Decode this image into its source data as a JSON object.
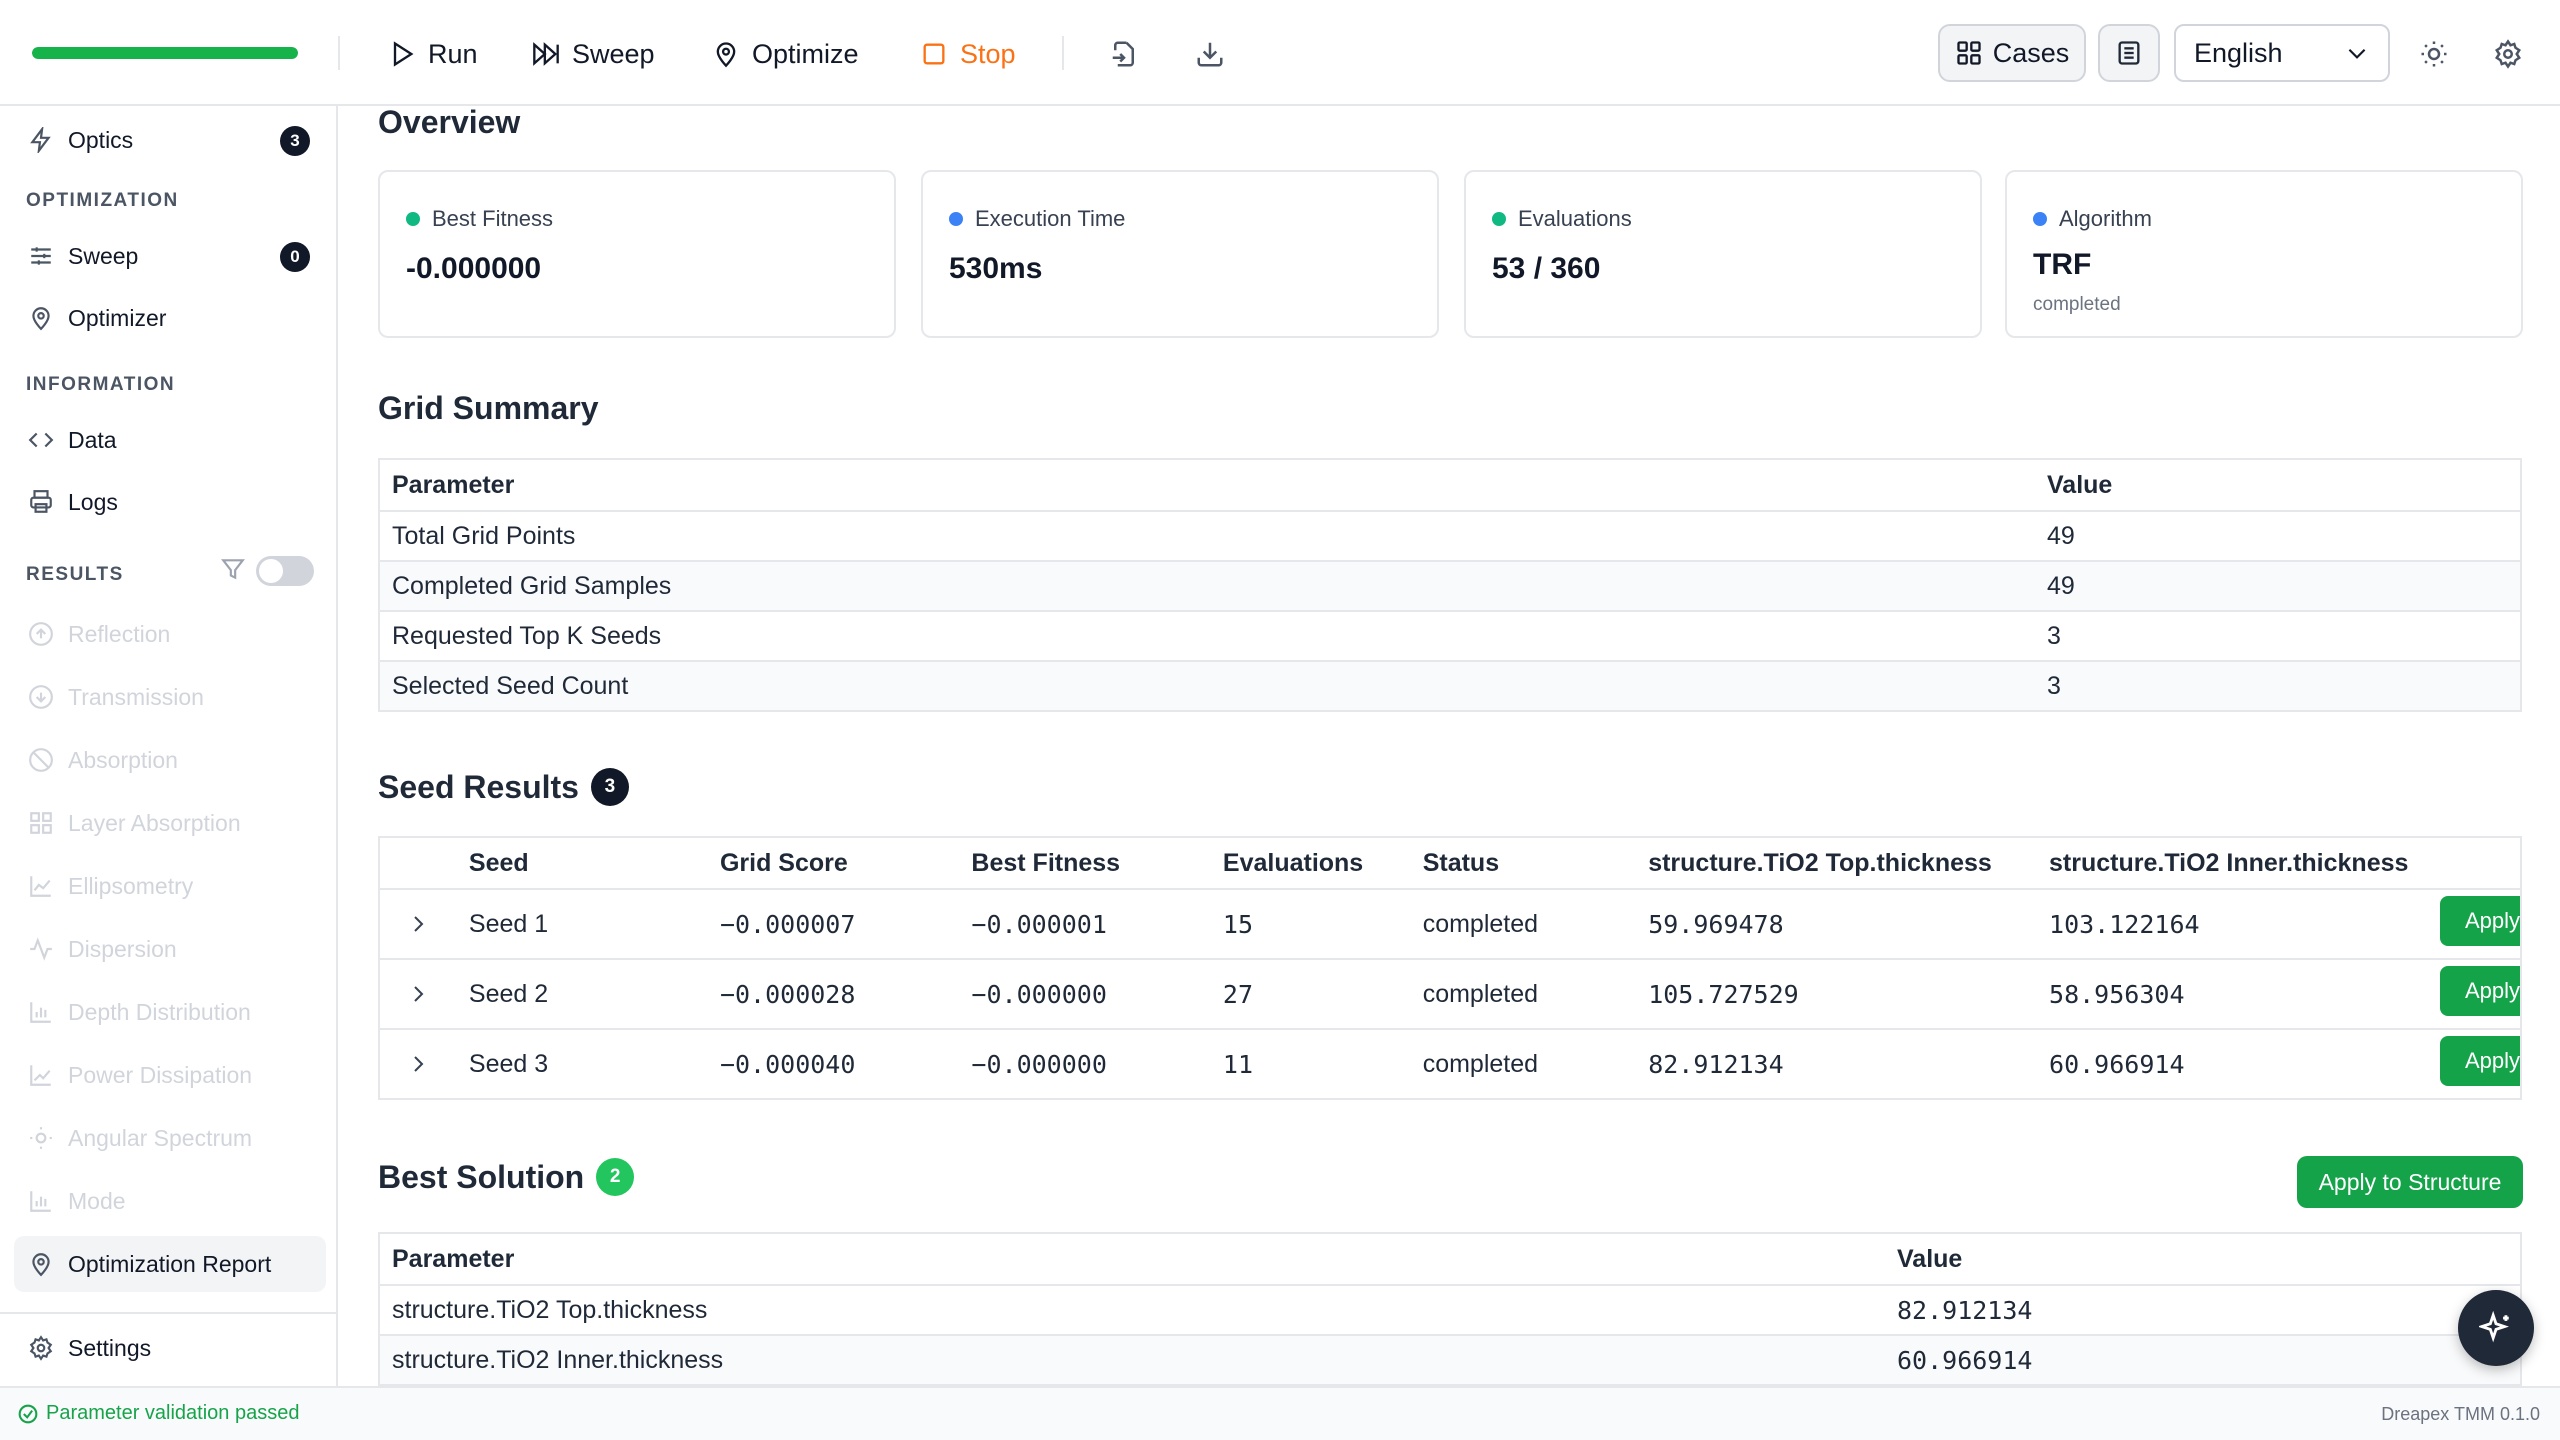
{
  "toolbar": {
    "progress": 1.0,
    "run_label": "Run",
    "sweep_label": "Sweep",
    "optimize_label": "Optimize",
    "stop_label": "Stop",
    "cases_label": "Cases",
    "language": "English",
    "colors": {
      "progress": "#16b34a",
      "stop": "#f97316"
    }
  },
  "sidebar": {
    "top_item": {
      "label": "Optics",
      "badge": "3",
      "icon": "bolt-icon"
    },
    "sections": {
      "optimization": "OPTIMIZATION",
      "information": "INFORMATION",
      "results": "RESULTS"
    },
    "optimization_items": [
      {
        "label": "Sweep",
        "badge": "0",
        "icon": "sliders-icon"
      },
      {
        "label": "Optimizer",
        "icon": "map-pin-icon"
      }
    ],
    "information_items": [
      {
        "label": "Data",
        "icon": "code-icon"
      },
      {
        "label": "Logs",
        "icon": "printer-icon"
      }
    ],
    "results_toggle_on": false,
    "results_items": [
      {
        "label": "Reflection",
        "icon": "arrow-up-circle-icon"
      },
      {
        "label": "Transmission",
        "icon": "arrow-down-circle-icon"
      },
      {
        "label": "Absorption",
        "icon": "ban-icon"
      },
      {
        "label": "Layer Absorption",
        "icon": "grid-icon"
      },
      {
        "label": "Ellipsometry",
        "icon": "area-chart-icon"
      },
      {
        "label": "Dispersion",
        "icon": "activity-icon"
      },
      {
        "label": "Depth Distribution",
        "icon": "bar-chart-icon"
      },
      {
        "label": "Power Dissipation",
        "icon": "line-chart-icon"
      },
      {
        "label": "Angular Spectrum",
        "icon": "sun-icon"
      },
      {
        "label": "Mode",
        "icon": "bar-chart-icon"
      }
    ],
    "active_item": {
      "label": "Optimization Report",
      "icon": "map-pin-icon"
    },
    "settings_label": "Settings"
  },
  "overview": {
    "title": "Overview",
    "cards": [
      {
        "label": "Best Fitness",
        "value": "-0.000000",
        "dot_color": "#10b981"
      },
      {
        "label": "Execution Time",
        "value": "530ms",
        "dot_color": "#3b82f6"
      },
      {
        "label": "Evaluations",
        "value": "53 / 360",
        "dot_color": "#10b981"
      },
      {
        "label": "Algorithm",
        "value": "TRF",
        "note": "completed",
        "dot_color": "#3b82f6"
      }
    ]
  },
  "grid_summary": {
    "title": "Grid Summary",
    "headers": [
      "Parameter",
      "Value"
    ],
    "rows": [
      [
        "Total Grid Points",
        "49"
      ],
      [
        "Completed Grid Samples",
        "49"
      ],
      [
        "Requested Top K Seeds",
        "3"
      ],
      [
        "Selected Seed Count",
        "3"
      ]
    ]
  },
  "seed_results": {
    "title": "Seed Results",
    "count": "3",
    "headers": [
      "Seed",
      "Grid Score",
      "Best Fitness",
      "Evaluations",
      "Status",
      "structure.TiO2 Top.thickness",
      "structure.TiO2 Inner.thickness"
    ],
    "apply_label": "Apply",
    "rows": [
      [
        "Seed 1",
        "−0.000007",
        "−0.000001",
        "15",
        "completed",
        "59.969478",
        "103.122164"
      ],
      [
        "Seed 2",
        "−0.000028",
        "−0.000000",
        "27",
        "completed",
        "105.727529",
        "58.956304"
      ],
      [
        "Seed 3",
        "−0.000040",
        "−0.000000",
        "11",
        "completed",
        "82.912134",
        "60.966914"
      ]
    ]
  },
  "best_solution": {
    "title": "Best Solution",
    "count": "2",
    "apply_label": "Apply to Structure",
    "headers": [
      "Parameter",
      "Value"
    ],
    "rows": [
      [
        "structure.TiO2 Top.thickness",
        "82.912134"
      ],
      [
        "structure.TiO2 Inner.thickness",
        "60.966914"
      ]
    ]
  },
  "status": {
    "message": "Parameter validation passed",
    "version": "Dreapex TMM 0.1.0"
  }
}
